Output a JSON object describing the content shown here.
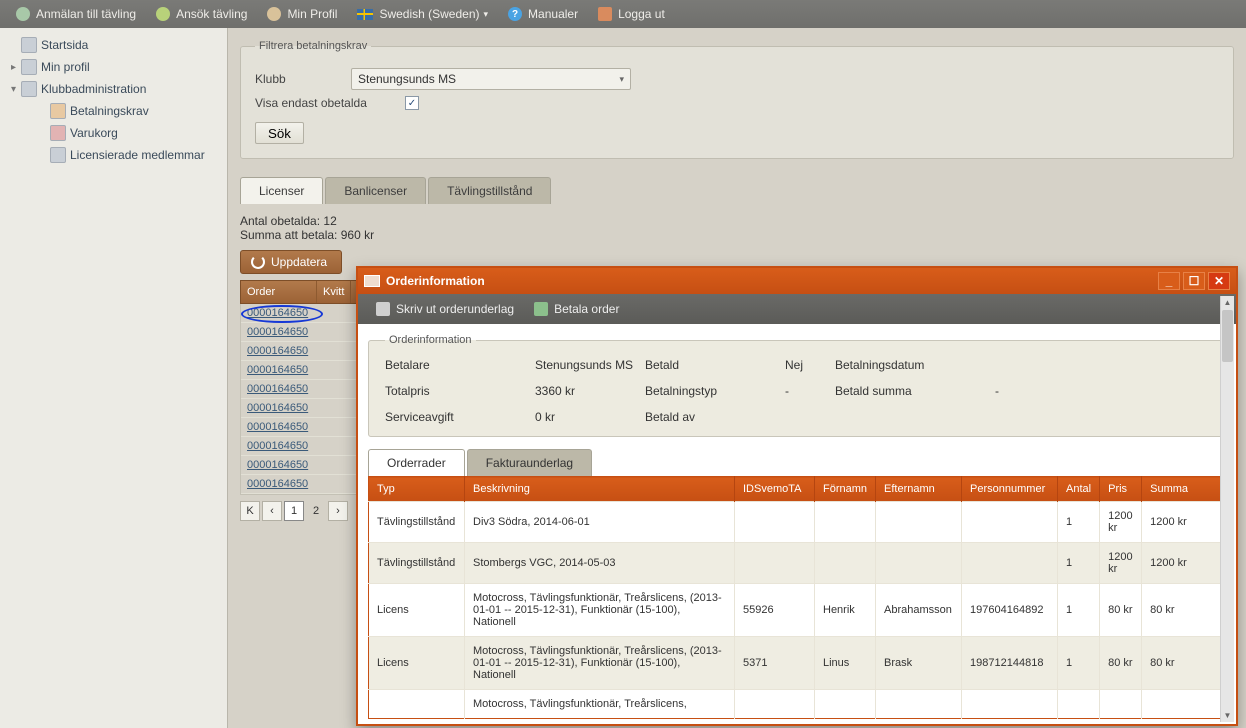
{
  "toolbar": {
    "register": "Anmälan till tävling",
    "apply": "Ansök tävling",
    "profile": "Min Profil",
    "language": "Swedish (Sweden)",
    "manuals": "Manualer",
    "logout": "Logga ut"
  },
  "tree": {
    "home": "Startsida",
    "myprofile": "Min profil",
    "clubadmin": "Klubbadministration",
    "paymentreq": "Betalningskrav",
    "cart": "Varukorg",
    "licmembers": "Licensierade medlemmar"
  },
  "filter": {
    "legend": "Filtrera betalningskrav",
    "club_label": "Klubb",
    "club_value": "Stenungsunds MS",
    "onlyunpaid_label": "Visa endast obetalda",
    "onlyunpaid_checked": "✓",
    "search_label": "Sök"
  },
  "tabs": {
    "licenser": "Licenser",
    "banlicenser": "Banlicenser",
    "tavling": "Tävlingstillstånd"
  },
  "summary": {
    "count": "Antal obetalda: 12",
    "sum": "Summa att betala: 960 kr"
  },
  "update_label": "Uppdatera",
  "grid": {
    "col_order": "Order",
    "col_kvitt": "Kvitt",
    "rows": [
      "0000164650",
      "0000164650",
      "0000164650",
      "0000164650",
      "0000164650",
      "0000164650",
      "0000164650",
      "0000164650",
      "0000164650",
      "0000164650"
    ]
  },
  "pager": {
    "page1": "1",
    "page2": "2"
  },
  "dialog": {
    "title": "Orderinformation",
    "print": "Skriv ut orderunderlag",
    "pay": "Betala order",
    "info_legend": "Orderinformation",
    "payer_label": "Betalare",
    "payer": "Stenungsunds MS",
    "paid_label": "Betald",
    "paid": "Nej",
    "paydate_label": "Betalningsdatum",
    "paydate": "",
    "total_label": "Totalpris",
    "total": "3360 kr",
    "paytype_label": "Betalningstyp",
    "paytype": "-",
    "paidsum_label": "Betald summa",
    "paidsum": "-",
    "fee_label": "Serviceavgift",
    "fee": "0 kr",
    "paidby_label": "Betald av",
    "paidby": "",
    "tab_lines": "Orderrader",
    "tab_invoice": "Fakturaunderlag",
    "cols": {
      "type": "Typ",
      "descr": "Beskrivning",
      "id": "IDSvemoTA",
      "first": "Förnamn",
      "last": "Efternamn",
      "pnr": "Personnummer",
      "qty": "Antal",
      "price": "Pris",
      "sum": "Summa"
    },
    "rows": [
      {
        "type": "Tävlingstillstånd",
        "descr": "Div3 Södra, 2014-06-01",
        "id": "",
        "first": "",
        "last": "",
        "pnr": "",
        "qty": "1",
        "price": "1200 kr",
        "sum": "1200 kr"
      },
      {
        "type": "Tävlingstillstånd",
        "descr": "Stombergs VGC, 2014-05-03",
        "id": "",
        "first": "",
        "last": "",
        "pnr": "",
        "qty": "1",
        "price": "1200 kr",
        "sum": "1200 kr"
      },
      {
        "type": "Licens",
        "descr": "Motocross, Tävlingsfunktionär, Treårslicens, (2013-01-01 -- 2015-12-31), Funktionär (15-100), Nationell",
        "id": "55926",
        "first": "Henrik",
        "last": "Abrahamsson",
        "pnr": "197604164892",
        "qty": "1",
        "price": "80 kr",
        "sum": "80 kr"
      },
      {
        "type": "Licens",
        "descr": "Motocross, Tävlingsfunktionär, Treårslicens, (2013-01-01 -- 2015-12-31), Funktionär (15-100), Nationell",
        "id": "5371",
        "first": "Linus",
        "last": "Brask",
        "pnr": "198712144818",
        "qty": "1",
        "price": "80 kr",
        "sum": "80 kr"
      },
      {
        "type": "",
        "descr": "Motocross, Tävlingsfunktionär, Treårslicens,",
        "id": "",
        "first": "",
        "last": "",
        "pnr": "",
        "qty": "",
        "price": "",
        "sum": ""
      }
    ]
  }
}
